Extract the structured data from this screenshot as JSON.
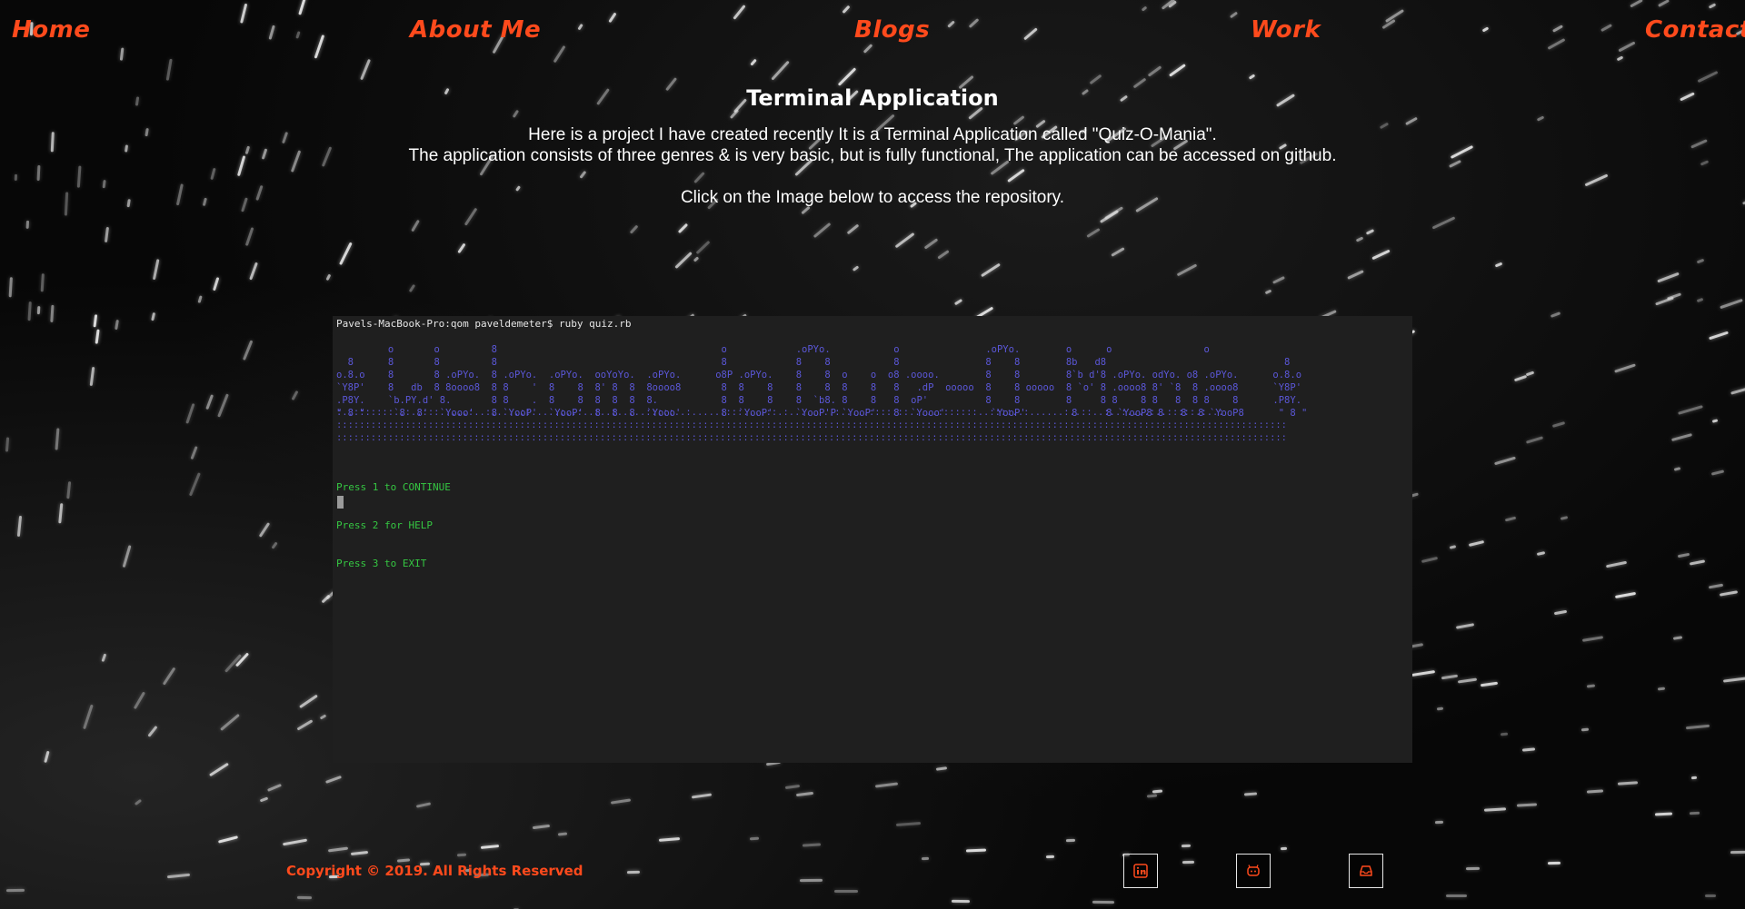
{
  "nav": {
    "home": "Home",
    "about": "About Me",
    "blogs": "Blogs",
    "work": "Work",
    "contact": "Contact"
  },
  "main": {
    "title": "Terminal Application",
    "line1": "Here is a project I have created recently It is a Terminal Application called \"Quiz-O-Mania\".",
    "line2": "The application consists of three genres & is very basic, but is fully functional, The application can be accessed on github.",
    "line3": "Click on the Image below to access the repository."
  },
  "terminal": {
    "prompt": "Pavels-MacBook-Pro:qom paveldemeter$ ruby quiz.rb",
    "ascii": "         o       o         8                                       o            .oPYo.           o               .oPYo.        o      o                o\n  8      8       8         8                                       8            8    8           8               8    8        8b   d8                               8\no.8.o    8       8 .oPYo.  8 .oPYo.  .oPYo.  ooYoYo.  .oPYo.      o8P .oPYo.    8    8  o    o  o8 .oooo.        8    8        8`b d'8 .oPYo. odYo. o8 .oPYo.      o.8.o\n`Y8P'    8   db  8 8oooo8  8 8    '  8    8  8' 8  8  8oooo8       8  8    8    8    8  8    8   8   .dP  ooooo  8    8 ooooo  8 `o' 8 .oooo8 8' `8  8 .oooo8      `Y8P'\n.P8Y.    `b.PY.d' 8.       8 8    .  8    8  8  8  8  8.           8  8    8    8  `b8. 8    8   8  oP'          8    8        8     8 8    8 8   8  8 8    8      .P8Y.\n\" 8 \"     `8  8'  `Yooo'   8 `YooP'  `YooP'  8  8  8  `Yooo'       8  `YooP'    `YooP'P `YooP'   8  `Yooo'        `YooP'        8     8 `YooP8 8   8  8 `YooP8      \" 8 \"",
    "dots": ":..:::::::..:..:::.....:..:.....::.....:..:..:..:.....:::::..:.....::::....::.:.....:..:.....:::::::.....:::::::..::::..:......:..::..:..:....:..:::::.:..:\n::::::::::::::::::::::::::::::::::::::::::::::::::::::::::::::::::::::::::::::::::::::::::::::::::::::::::::::::::::::::::::::::::::::::::::::::::::::::::::::::::::::\n::::::::::::::::::::::::::::::::::::::::::::::::::::::::::::::::::::::::::::::::::::::::::::::::::::::::::::::::::::::::::::::::::::::::::::::::::::::::::::::::::::::",
    "menu1": "Press 1 to CONTINUE",
    "menu2": "Press 2 for HELP",
    "menu3": "Press 3 to EXIT"
  },
  "footer": {
    "copyright": "Copyright © 2019. All Rights Reserved",
    "icons": [
      "linkedin-icon",
      "github-icon",
      "inbox-icon"
    ]
  },
  "colors": {
    "accent": "#ff4a1c",
    "terminal_bg": "#1f1f1f",
    "ascii": "#5b57d8",
    "menu": "#35c742"
  }
}
